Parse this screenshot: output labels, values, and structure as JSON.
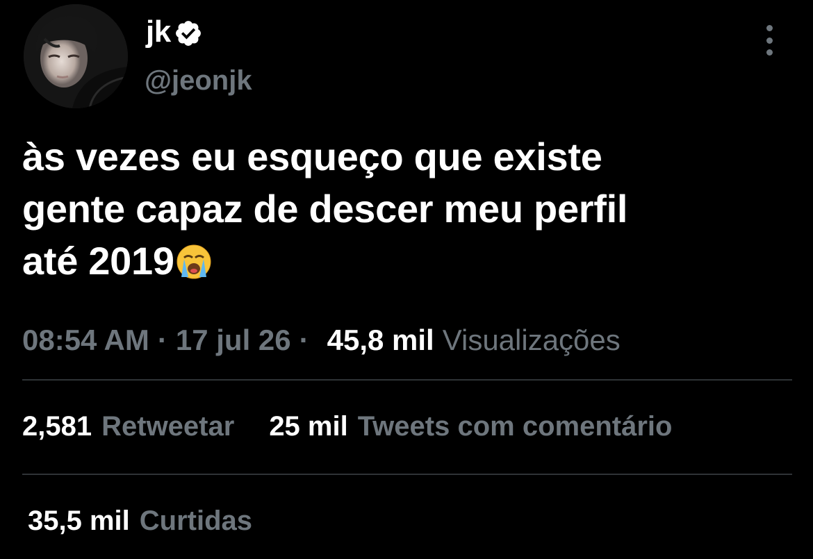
{
  "user": {
    "display_name": "jk",
    "handle": "@jeonjk",
    "verified": true
  },
  "tweet": {
    "text_lines": [
      "às vezes eu esqueço que existe",
      "gente capaz de descer meu perfil",
      "até 2019"
    ],
    "trailing_emoji": "loudly-crying-face-emoji"
  },
  "meta": {
    "time": "08:54 AM",
    "separator": "·",
    "date": "17 jul 26",
    "separator2": "·",
    "views_count": "45,8 mil",
    "views_label": "Visualizações"
  },
  "stats": {
    "retweets": {
      "count": "2,581",
      "label": "Retweetar"
    },
    "quotes": {
      "count": "25 mil",
      "label": "Tweets com comentário"
    },
    "likes": {
      "count": "35,5 mil",
      "label": "Curtidas"
    }
  },
  "icons": {
    "verified": "verified-badge-icon",
    "more": "more-options-icon"
  },
  "colors": {
    "background": "#000000",
    "primary_text": "#ffffff",
    "secondary_text": "#6e767d",
    "divider": "#2f3336"
  }
}
